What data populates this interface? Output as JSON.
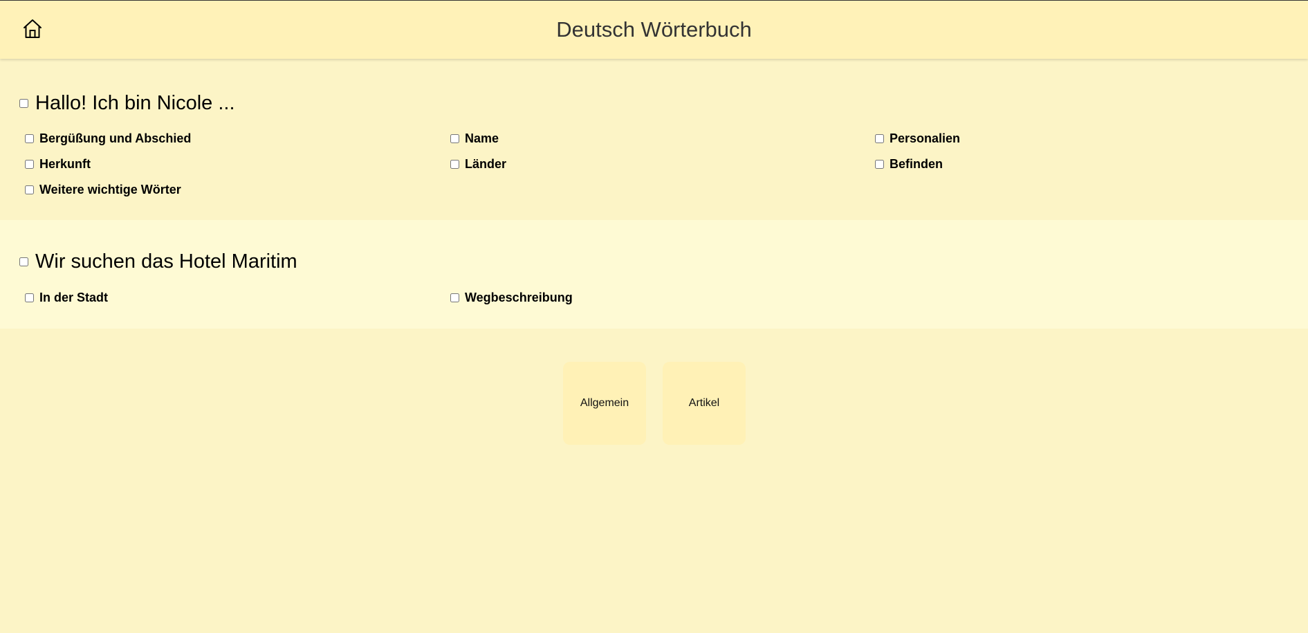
{
  "header": {
    "title": "Deutsch Wörterbuch",
    "home_icon": "home-icon"
  },
  "sections": [
    {
      "title": "Hallo! Ich bin Nicole ...",
      "items": [
        "Bergüßung und Abschied",
        "Name",
        "Personalien",
        "Herkunft",
        "Länder",
        "Befinden",
        "Weitere wichtige Wörter"
      ]
    },
    {
      "title": "Wir suchen das Hotel Maritim",
      "items": [
        "In der Stadt",
        "Wegbeschreibung"
      ]
    }
  ],
  "buttons": {
    "general": "Allgemein",
    "article": "Artikel"
  },
  "colors": {
    "header_bg": "#fff2b8",
    "page_bg": "#fcf4c6",
    "section_alt_bg": "#fefad4",
    "button_bg": "#fff1b6"
  }
}
